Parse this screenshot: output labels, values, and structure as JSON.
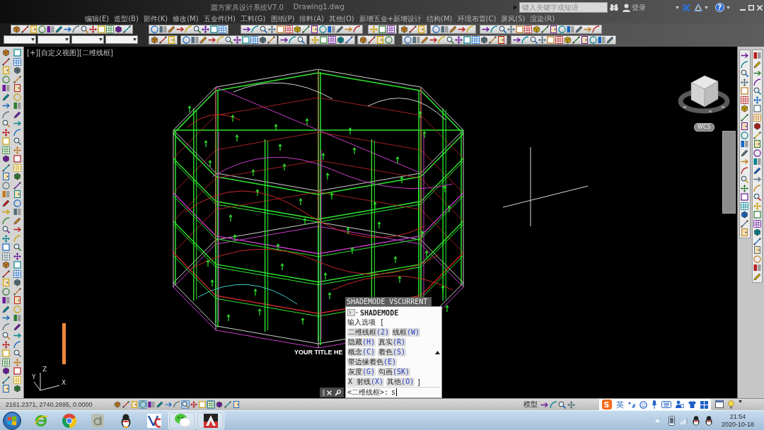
{
  "window": {
    "title": "圆方家具设计系统V7.0",
    "document": "Drawing1.dwg"
  },
  "search": {
    "placeholder": "键入关键字或短语"
  },
  "account": {
    "label": "登录"
  },
  "help": {
    "label": "?"
  },
  "menu": [
    "编辑(E)",
    "造型(B)",
    "部件(K)",
    "修改(M)",
    "五金件(H)",
    "工料(G)",
    "图纸(P)",
    "排料(A)",
    "其他(O)",
    "新增五金+新增设计",
    "结构(M)",
    "环境布置(C)",
    "屏风(S)",
    "渲染(R)"
  ],
  "viewport": {
    "label": "[+][自定义视图][二维线框]",
    "wcs": "WCS",
    "axes": {
      "y": "Y",
      "z": "Z",
      "x": "X"
    }
  },
  "command_popup": {
    "header": "SHADEMODE VSCURRENT",
    "command": "SHADEMODE",
    "prompt": "输入选项 [",
    "option_rows": [
      [
        {
          "name": "二维线框",
          "key": "(2)"
        },
        {
          "name": "线框",
          "key": "(W)"
        }
      ],
      [
        {
          "name": "隐藏",
          "key": "(H)"
        },
        {
          "name": "真实",
          "key": "(R)"
        }
      ],
      [
        {
          "name": "概念",
          "key": "(C)"
        },
        {
          "name": "着色",
          "key": "(S)"
        }
      ],
      [
        {
          "name": "带边缘着色",
          "key": "(E)"
        }
      ],
      [
        {
          "name": "灰度",
          "key": "(G)"
        },
        {
          "name": "勾画",
          "key": "(SK)"
        }
      ],
      [
        {
          "name": "X 射线",
          "key": "(X)"
        },
        {
          "name": "其他",
          "key": "(O)"
        }
      ]
    ],
    "closing": "]",
    "input_prompt": "<二维线框>:",
    "input_value": "s"
  },
  "video_overlay": {
    "title": "YOUR TITLE HE"
  },
  "status_bar": {
    "coordinates": "2161.2371, 2740.2695, 0.0000",
    "toggles": [
      {
        "on": false
      },
      {
        "on": false
      },
      {
        "on": false
      },
      {
        "on": true
      },
      {
        "on": false
      },
      {
        "on": false
      },
      {
        "on": false
      },
      {
        "on": false
      },
      {
        "on": true
      },
      {
        "on": false
      },
      {
        "on": false
      },
      {
        "on": true
      },
      {
        "on": false
      },
      {
        "on": false
      },
      {
        "on": false
      }
    ],
    "space": "模型",
    "ime": {
      "logo": "S",
      "language": "英"
    }
  },
  "taskbar": {
    "buttons": [
      {
        "open": false
      },
      {
        "open": false
      },
      {
        "open": false
      },
      {
        "open": false
      },
      {
        "open": false
      },
      {
        "open": true
      },
      {
        "open": true
      }
    ],
    "time": "21:54",
    "date": "2020-10-18"
  }
}
